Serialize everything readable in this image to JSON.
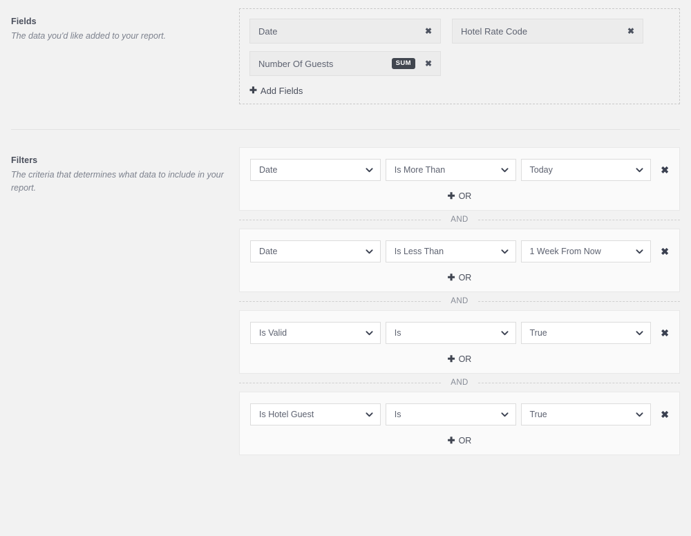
{
  "sections": {
    "fields": {
      "title": "Fields",
      "description": "The data you'd like added to your report.",
      "chips": [
        {
          "label": "Date",
          "badge": null,
          "remove_icon": "✖"
        },
        {
          "label": "Hotel Rate Code",
          "badge": null,
          "remove_icon": "✖"
        },
        {
          "label": "Number Of Guests",
          "badge": "SUM",
          "remove_icon": "✖"
        }
      ],
      "add_fields_label": "Add Fields",
      "add_fields_icon": "✚"
    },
    "filters": {
      "title": "Filters",
      "description": "The criteria that determines what data to include in your report.",
      "and_label": "AND",
      "or_label": "OR",
      "or_icon": "✚",
      "remove_icon": "✖",
      "groups": [
        {
          "field": "Date",
          "operator": "Is More Than",
          "value": "Today"
        },
        {
          "field": "Date",
          "operator": "Is Less Than",
          "value": "1 Week From Now"
        },
        {
          "field": "Is Valid",
          "operator": "Is",
          "value": "True"
        },
        {
          "field": "Is Hotel Guest",
          "operator": "Is",
          "value": "True"
        }
      ]
    }
  },
  "colors": {
    "page_background": "#f2f2f2",
    "chip_background": "#ececec",
    "badge_background": "#41464f",
    "text": "#5a5f6e",
    "border": "#dcdcdc"
  }
}
